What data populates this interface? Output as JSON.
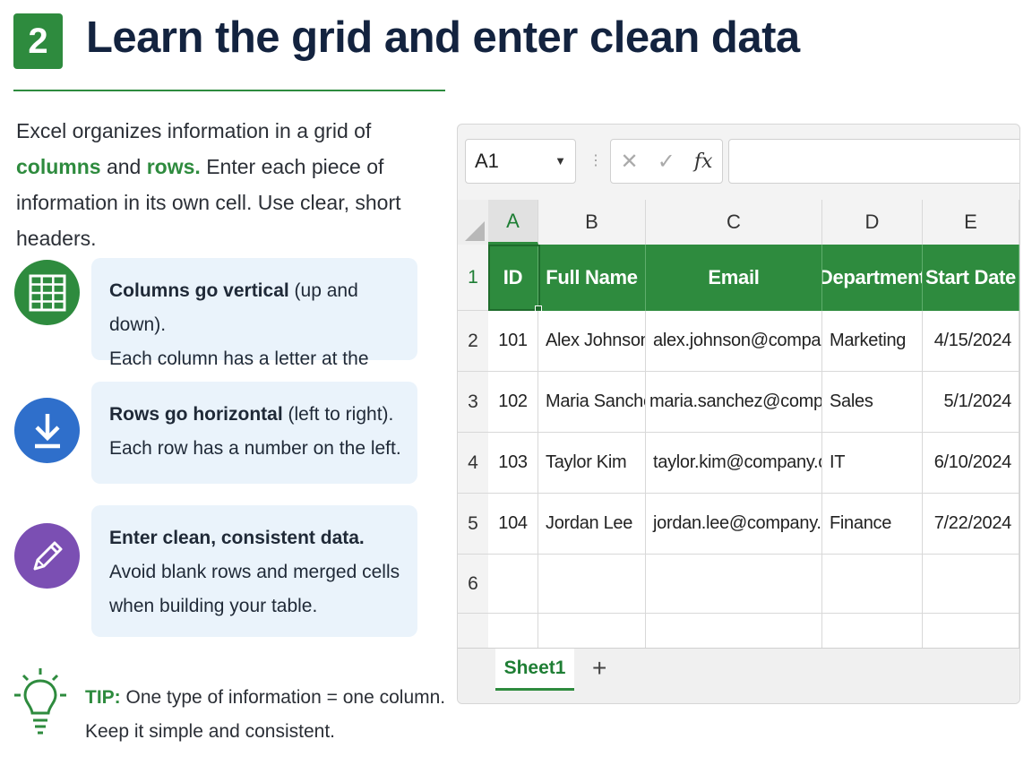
{
  "header": {
    "step_number": "2",
    "title": "Learn the grid and enter clean data"
  },
  "intro": {
    "part1": "Excel organizes information in a grid of ",
    "columns_word": "columns",
    "part2": " and ",
    "rows_word": "rows.",
    "part3": " Enter each piece of information in its own cell. Use clear, short headers."
  },
  "cards": [
    {
      "icon": "grid-icon",
      "icon_color": "#2e8b3e",
      "bold": "Columns go vertical",
      "rest": " (up and down).",
      "line2": "Each column has a letter at the top."
    },
    {
      "icon": "download-arrow-icon",
      "icon_color": "#2f6fcb",
      "bold": "Rows go horizontal",
      "rest": " (left to right).",
      "line2": "Each row has a number on the left."
    },
    {
      "icon": "pencil-icon",
      "icon_color": "#7b4fb3",
      "bold": "Enter clean, consistent data.",
      "rest": "",
      "line2": "Avoid blank rows and merged cells when building your table."
    }
  ],
  "tip": {
    "label": "TIP:",
    "line1": " One type of information = one column.",
    "line2": "Keep it simple and consistent."
  },
  "excel": {
    "name_box": "A1",
    "fx_label": "fx",
    "columns": [
      "A",
      "B",
      "C",
      "D",
      "E"
    ],
    "rows": [
      "1",
      "2",
      "3",
      "4",
      "5",
      "6"
    ],
    "table_headers": [
      "ID",
      "Full Name",
      "Email",
      "Department",
      "Start Date"
    ],
    "table_rows": [
      [
        "101",
        "Alex Johnson",
        "alex.johnson@company.com",
        "Marketing",
        "4/15/2024"
      ],
      [
        "102",
        "Maria Sanchez",
        "maria.sanchez@company.com",
        "Sales",
        "5/1/2024"
      ],
      [
        "103",
        "Taylor Kim",
        "taylor.kim@company.com",
        "IT",
        "6/10/2024"
      ],
      [
        "104",
        "Jordan Lee",
        "jordan.lee@company.com",
        "Finance",
        "7/22/2024"
      ]
    ],
    "sheet_tab": "Sheet1",
    "add_sheet": "+",
    "accent": "#2e8b3e"
  }
}
